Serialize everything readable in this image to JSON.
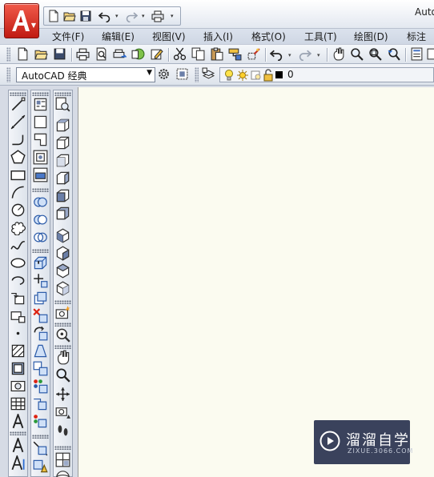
{
  "window": {
    "title": "Auto"
  },
  "menu": [
    {
      "label": "文件(F)"
    },
    {
      "label": "编辑(E)"
    },
    {
      "label": "视图(V)"
    },
    {
      "label": "插入(I)"
    },
    {
      "label": "格式(O)"
    },
    {
      "label": "工具(T)"
    },
    {
      "label": "绘图(D)"
    },
    {
      "label": "标注"
    }
  ],
  "workspace": {
    "selected": "AutoCAD 经典"
  },
  "layer": {
    "current": "0"
  },
  "watermark": {
    "brand": "溜溜自学",
    "url": "ZIXUE.3066.COM"
  },
  "colors": {
    "drawing_background": "#fbfbf0",
    "app_button": "#d2231a",
    "watermark_bg": "#172142"
  }
}
